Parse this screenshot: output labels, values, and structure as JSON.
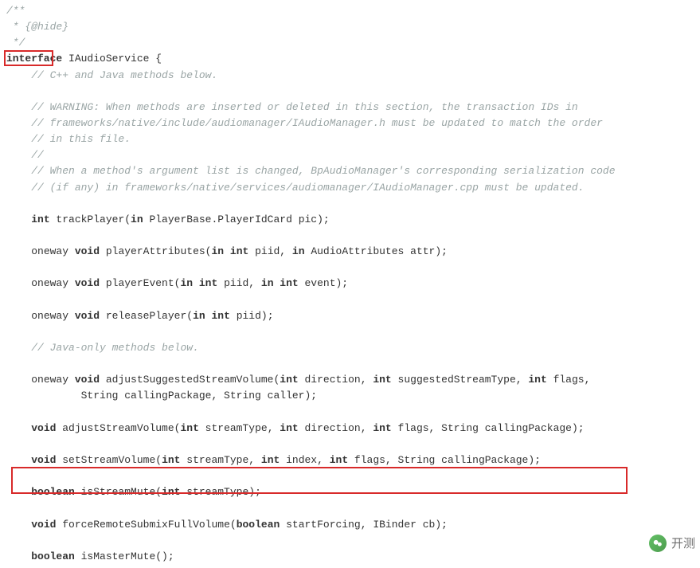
{
  "lines": [
    {
      "indent": 0,
      "parts": [
        {
          "cls": "comment",
          "text": "/**"
        }
      ]
    },
    {
      "indent": 0,
      "parts": [
        {
          "cls": "comment",
          "text": " * {@hide}"
        }
      ]
    },
    {
      "indent": 0,
      "parts": [
        {
          "cls": "comment",
          "text": " */"
        }
      ]
    },
    {
      "indent": 0,
      "parts": [
        {
          "cls": "kw",
          "text": "interface"
        },
        {
          "cls": "plain",
          "text": " IAudioService {"
        }
      ]
    },
    {
      "indent": 1,
      "parts": [
        {
          "cls": "comment",
          "text": "// C++ and Java methods below."
        }
      ]
    },
    {
      "indent": 0,
      "parts": []
    },
    {
      "indent": 1,
      "parts": [
        {
          "cls": "comment",
          "text": "// WARNING: When methods are inserted or deleted in this section, the transaction IDs in"
        }
      ]
    },
    {
      "indent": 1,
      "parts": [
        {
          "cls": "comment",
          "text": "// frameworks/native/include/audiomanager/IAudioManager.h must be updated to match the order"
        }
      ]
    },
    {
      "indent": 1,
      "parts": [
        {
          "cls": "comment",
          "text": "// in this file."
        }
      ]
    },
    {
      "indent": 1,
      "parts": [
        {
          "cls": "comment",
          "text": "//"
        }
      ]
    },
    {
      "indent": 1,
      "parts": [
        {
          "cls": "comment",
          "text": "// When a method's argument list is changed, BpAudioManager's corresponding serialization code"
        }
      ]
    },
    {
      "indent": 1,
      "parts": [
        {
          "cls": "comment",
          "text": "// (if any) in frameworks/native/services/audiomanager/IAudioManager.cpp must be updated."
        }
      ]
    },
    {
      "indent": 0,
      "parts": []
    },
    {
      "indent": 1,
      "parts": [
        {
          "cls": "kw",
          "text": "int"
        },
        {
          "cls": "plain",
          "text": " trackPlayer("
        },
        {
          "cls": "kw",
          "text": "in"
        },
        {
          "cls": "plain",
          "text": " PlayerBase.PlayerIdCard pic);"
        }
      ]
    },
    {
      "indent": 0,
      "parts": []
    },
    {
      "indent": 1,
      "parts": [
        {
          "cls": "plain",
          "text": "oneway "
        },
        {
          "cls": "kw",
          "text": "void"
        },
        {
          "cls": "plain",
          "text": " playerAttributes("
        },
        {
          "cls": "kw",
          "text": "in int"
        },
        {
          "cls": "plain",
          "text": " piid, "
        },
        {
          "cls": "kw",
          "text": "in"
        },
        {
          "cls": "plain",
          "text": " AudioAttributes attr);"
        }
      ]
    },
    {
      "indent": 0,
      "parts": []
    },
    {
      "indent": 1,
      "parts": [
        {
          "cls": "plain",
          "text": "oneway "
        },
        {
          "cls": "kw",
          "text": "void"
        },
        {
          "cls": "plain",
          "text": " playerEvent("
        },
        {
          "cls": "kw",
          "text": "in int"
        },
        {
          "cls": "plain",
          "text": " piid, "
        },
        {
          "cls": "kw",
          "text": "in int"
        },
        {
          "cls": "plain",
          "text": " event);"
        }
      ]
    },
    {
      "indent": 0,
      "parts": []
    },
    {
      "indent": 1,
      "parts": [
        {
          "cls": "plain",
          "text": "oneway "
        },
        {
          "cls": "kw",
          "text": "void"
        },
        {
          "cls": "plain",
          "text": " releasePlayer("
        },
        {
          "cls": "kw",
          "text": "in int"
        },
        {
          "cls": "plain",
          "text": " piid);"
        }
      ]
    },
    {
      "indent": 0,
      "parts": []
    },
    {
      "indent": 1,
      "parts": [
        {
          "cls": "comment",
          "text": "// Java-only methods below."
        }
      ]
    },
    {
      "indent": 0,
      "parts": []
    },
    {
      "indent": 1,
      "parts": [
        {
          "cls": "plain",
          "text": "oneway "
        },
        {
          "cls": "kw",
          "text": "void"
        },
        {
          "cls": "plain",
          "text": " adjustSuggestedStreamVolume("
        },
        {
          "cls": "kw",
          "text": "int"
        },
        {
          "cls": "plain",
          "text": " direction, "
        },
        {
          "cls": "kw",
          "text": "int"
        },
        {
          "cls": "plain",
          "text": " suggestedStreamType, "
        },
        {
          "cls": "kw",
          "text": "int"
        },
        {
          "cls": "plain",
          "text": " flags,"
        }
      ]
    },
    {
      "indent": 3,
      "parts": [
        {
          "cls": "plain",
          "text": "String callingPackage, String caller);"
        }
      ]
    },
    {
      "indent": 0,
      "parts": []
    },
    {
      "indent": 1,
      "parts": [
        {
          "cls": "kw",
          "text": "void"
        },
        {
          "cls": "plain",
          "text": " adjustStreamVolume("
        },
        {
          "cls": "kw",
          "text": "int"
        },
        {
          "cls": "plain",
          "text": " streamType, "
        },
        {
          "cls": "kw",
          "text": "int"
        },
        {
          "cls": "plain",
          "text": " direction, "
        },
        {
          "cls": "kw",
          "text": "int"
        },
        {
          "cls": "plain",
          "text": " flags, String callingPackage);"
        }
      ]
    },
    {
      "indent": 0,
      "parts": []
    },
    {
      "indent": 1,
      "parts": [
        {
          "cls": "kw",
          "text": "void"
        },
        {
          "cls": "plain",
          "text": " setStreamVolume("
        },
        {
          "cls": "kw",
          "text": "int"
        },
        {
          "cls": "plain",
          "text": " streamType, "
        },
        {
          "cls": "kw",
          "text": "int"
        },
        {
          "cls": "plain",
          "text": " index, "
        },
        {
          "cls": "kw",
          "text": "int"
        },
        {
          "cls": "plain",
          "text": " flags, String callingPackage);"
        }
      ]
    },
    {
      "indent": 0,
      "parts": []
    },
    {
      "indent": 1,
      "parts": [
        {
          "cls": "kw",
          "text": "boolean"
        },
        {
          "cls": "plain",
          "text": " isStreamMute("
        },
        {
          "cls": "kw",
          "text": "int"
        },
        {
          "cls": "plain",
          "text": " streamType);"
        }
      ]
    },
    {
      "indent": 0,
      "parts": []
    },
    {
      "indent": 1,
      "parts": [
        {
          "cls": "kw",
          "text": "void"
        },
        {
          "cls": "plain",
          "text": " forceRemoteSubmixFullVolume("
        },
        {
          "cls": "kw",
          "text": "boolean"
        },
        {
          "cls": "plain",
          "text": " startForcing, IBinder cb);"
        }
      ]
    },
    {
      "indent": 0,
      "parts": []
    },
    {
      "indent": 1,
      "parts": [
        {
          "cls": "kw",
          "text": "boolean"
        },
        {
          "cls": "plain",
          "text": " isMasterMute();"
        }
      ]
    }
  ],
  "watermark": {
    "text": "开测"
  }
}
